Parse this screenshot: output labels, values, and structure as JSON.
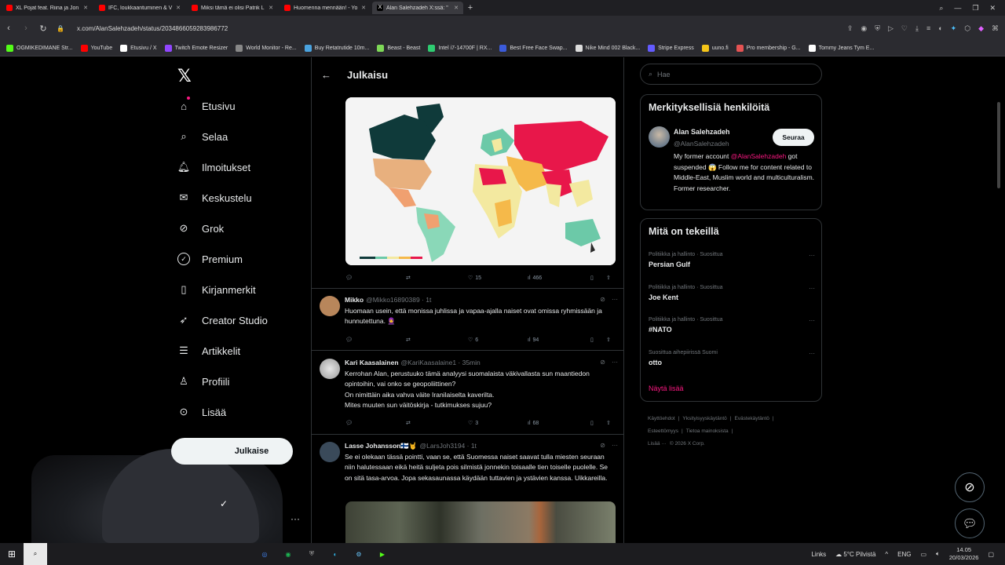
{
  "browser": {
    "tabs": [
      {
        "label": "XL Pojat feat. Riina ja Jon",
        "color": "#ff0000"
      },
      {
        "label": "IFC, loukkaantuminen & V",
        "color": "#ff0000"
      },
      {
        "label": "Miksi tämä ei olisi Patrik L",
        "color": "#ff0000"
      },
      {
        "label": "Huomenna mennään! - Yo",
        "color": "#ff0000"
      },
      {
        "label": "Alan Salehzadeh X:ssä: \"",
        "color": "#ffffff",
        "active": true
      }
    ],
    "url": "x.com/AlanSalehzadeh/status/2034866059283986772",
    "bookmarks": [
      {
        "label": "OGMIKEDIMANE Str...",
        "color": "#53fc18"
      },
      {
        "label": "YouTube",
        "color": "#ff0000"
      },
      {
        "label": "Etusivu / X",
        "color": "#ffffff"
      },
      {
        "label": "Twitch Emote Resizer",
        "color": "#9146ff"
      },
      {
        "label": "World Monitor - Re...",
        "color": "#888888"
      },
      {
        "label": "Buy Retatrutide 10m...",
        "color": "#4aa3df"
      },
      {
        "label": "Beast - Beast",
        "color": "#7ed957"
      },
      {
        "label": "Intel i7-14700F | RX...",
        "color": "#2ecc71"
      },
      {
        "label": "Best Free Face Swap...",
        "color": "#3b5bdb"
      },
      {
        "label": "Nike Mind 002 Black...",
        "color": "#dddddd"
      },
      {
        "label": "Stripe Express",
        "color": "#635bff"
      },
      {
        "label": "uuno.fi",
        "color": "#f5c518"
      },
      {
        "label": "Pro membership - G...",
        "color": "#e55353"
      },
      {
        "label": "Tommy Jeans Tym E...",
        "color": "#ffffff"
      }
    ]
  },
  "nav": {
    "items": [
      {
        "label": "Etusivu",
        "icon": "home-icon"
      },
      {
        "label": "Selaa",
        "icon": "search-icon"
      },
      {
        "label": "Ilmoitukset",
        "icon": "bell-icon"
      },
      {
        "label": "Keskustelu",
        "icon": "mail-icon"
      },
      {
        "label": "Grok",
        "icon": "grok-icon"
      },
      {
        "label": "Premium",
        "icon": "verified-icon"
      },
      {
        "label": "Kirjanmerkit",
        "icon": "bookmark-icon"
      },
      {
        "label": "Creator Studio",
        "icon": "rocket-icon"
      },
      {
        "label": "Artikkelit",
        "icon": "article-icon"
      },
      {
        "label": "Profiili",
        "icon": "person-icon"
      },
      {
        "label": "Lisää",
        "icon": "more-circle-icon"
      }
    ],
    "post_label": "Julkaise"
  },
  "main": {
    "title": "Julkaisu",
    "post_stats": {
      "likes": "15",
      "views": "466"
    },
    "replies": [
      {
        "name": "Mikko",
        "handle": "@Mikko16890389 · 1t",
        "text": "Huomaan usein, että monissa juhlissa ja vapaa-ajalla naiset ovat omissa ryhmissään ja hunnutettuna. 🧕",
        "likes": "6",
        "views": "94",
        "avatar_color": "#b8865b"
      },
      {
        "name": "Kari Kaasalainen",
        "handle": "@KariKaasalaine1 · 35min",
        "text": "Kerrohan Alan, perustuuko tämä analyysi suomalaista väkivallasta sun maantiedon opintoihin, vai onko se geopoliittinen?\nOn nimittäin aika vahva väite Iranilaiselta kaverilta.\nMites muuten sun väitöskirja - tutkimukses sujuu?",
        "likes": "3",
        "views": "68",
        "avatar_color": "#d9d9d9"
      },
      {
        "name": "Lasse Johansson🇫🇮🤘",
        "handle": "@LarsJoh3194 · 1t",
        "text": "Se ei olekaan tässä pointti, vaan se, että Suomessa naiset saavat tulla miesten seuraan niin halutessaan eikä heitä suljeta pois silmistä jonnekin toisaalle tien toiselle puolelle. Se on sitä tasa-arvoa. Jopa sekasaunassa käydään tuttavien ja ystävien kanssa. Uikkareilla.",
        "avatar_color": "#3a4a5a"
      }
    ]
  },
  "sidebar": {
    "search_placeholder": "Hae",
    "relevant_title": "Merkityksellisiä henkilöitä",
    "person": {
      "name": "Alan Salehzadeh",
      "handle": "@AlanSalehzadeh",
      "follow_label": "Seuraa",
      "bio_before": "My former account ",
      "bio_mention": "@AlanSalehzadeh",
      "bio_after": " got suspended 😱 Follow me for content related to Middle-East, Muslim world and multiculturalism. Former researcher."
    },
    "trends_title": "Mitä on tekeillä",
    "trends": [
      {
        "category": "Politiikka ja hallinto · Suosittua",
        "name": "Persian Gulf"
      },
      {
        "category": "Politiikka ja hallinto · Suosittua",
        "name": "Joe Kent"
      },
      {
        "category": "Politiikka ja hallinto · Suosittua",
        "name": "#NATO"
      },
      {
        "category": "Suosittua aihepiirissä Suomi",
        "name": "otto"
      }
    ],
    "show_more": "Näytä lisää",
    "footer": [
      "Käyttöehdot",
      "|",
      "Yksityisyyskäytäntö",
      "|",
      "Evästekäytäntö",
      "|",
      "Esteettömyys",
      "|",
      "Tietoa mainoksista",
      "|",
      "Lisää ···",
      "© 2026 X Corp."
    ]
  },
  "taskbar": {
    "links": "Links",
    "weather": "5°C  Pilvistä",
    "lang": "ENG",
    "time": "14.05",
    "date": "20/03/2026"
  },
  "colors": {
    "accent": "#f91880",
    "background": "#000000",
    "border": "#2f3336",
    "muted": "#71767b"
  }
}
